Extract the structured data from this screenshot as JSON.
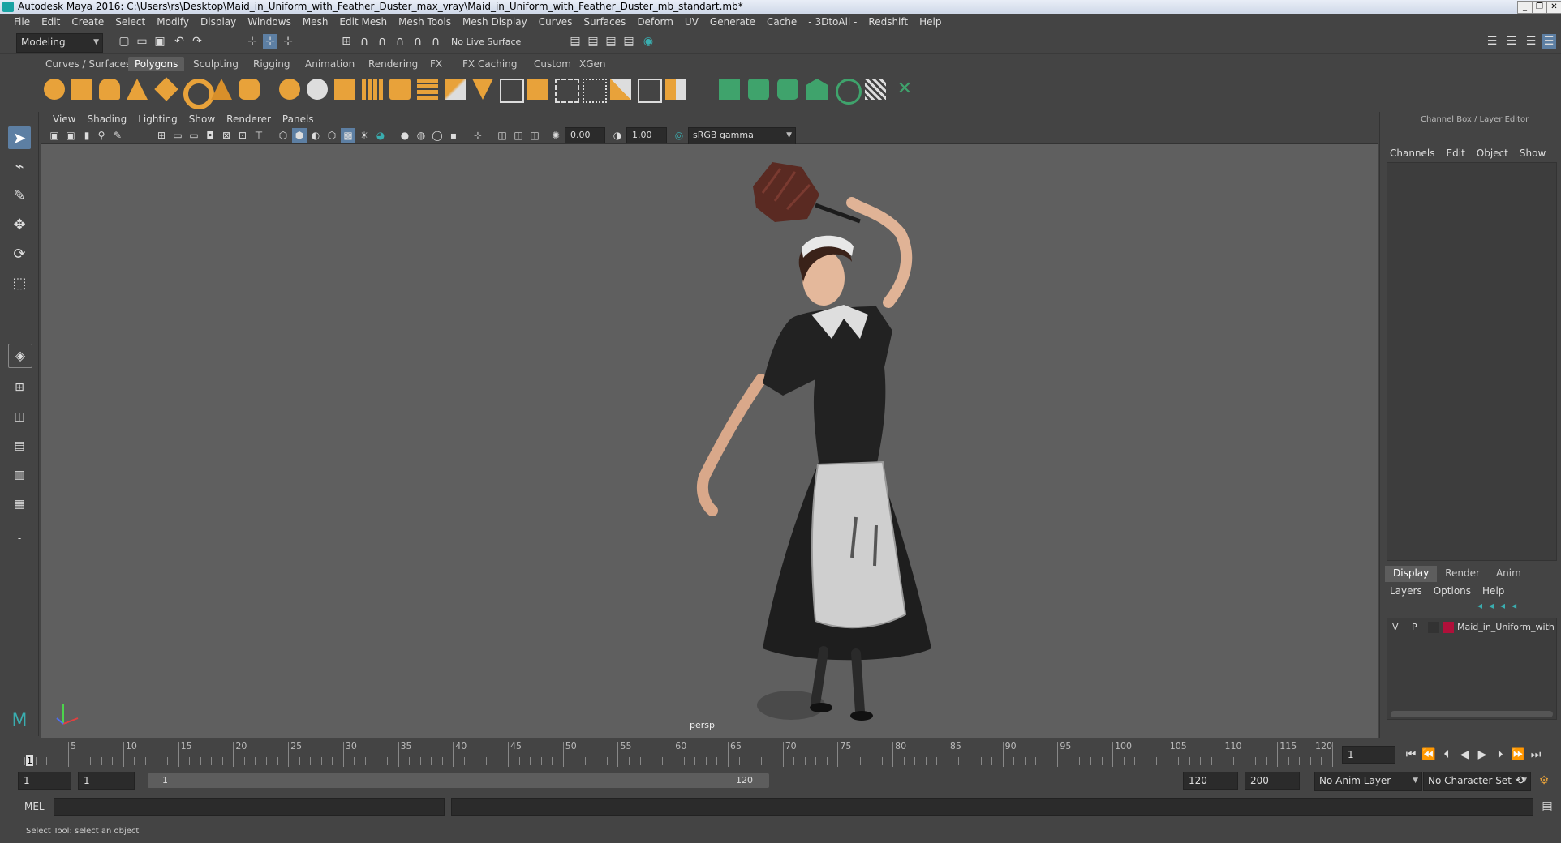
{
  "window": {
    "title": "Autodesk Maya 2016: C:\\Users\\rs\\Desktop\\Maid_in_Uniform_with_Feather_Duster_max_vray\\Maid_in_Uniform_with_Feather_Duster_mb_standart.mb*"
  },
  "menus": [
    "File",
    "Edit",
    "Create",
    "Select",
    "Modify",
    "Display",
    "Windows",
    "Mesh",
    "Edit Mesh",
    "Mesh Tools",
    "Mesh Display",
    "Curves",
    "Surfaces",
    "Deform",
    "UV",
    "Generate",
    "Cache",
    "- 3DtoAll -",
    "Redshift",
    "Help"
  ],
  "statusline": {
    "mode": "Modeling",
    "live_surface": "No Live Surface"
  },
  "shelf_tabs": [
    "Curves / Surfaces",
    "Polygons",
    "Sculpting",
    "Rigging",
    "Animation",
    "Rendering",
    "FX",
    "FX Caching",
    "Custom",
    "XGen"
  ],
  "shelf_active": "Polygons",
  "viewport": {
    "menus": [
      "View",
      "Shading",
      "Lighting",
      "Show",
      "Renderer",
      "Panels"
    ],
    "exposure": "0.00",
    "gamma": "1.00",
    "color_space": "sRGB gamma",
    "camera_label": "persp"
  },
  "channel_box": {
    "title": "Channel Box / Layer Editor",
    "menus": [
      "Channels",
      "Edit",
      "Object",
      "Show"
    ],
    "layer_tabs": [
      "Display",
      "Render",
      "Anim"
    ],
    "layer_menus": [
      "Layers",
      "Options",
      "Help"
    ],
    "layer": {
      "v": "V",
      "p": "P",
      "name": "Maid_in_Uniform_with",
      "color": "#b0103a"
    }
  },
  "timeline": {
    "ticks": [
      "5",
      "10",
      "15",
      "20",
      "25",
      "30",
      "35",
      "40",
      "45",
      "50",
      "55",
      "60",
      "65",
      "70",
      "75",
      "80",
      "85",
      "90",
      "95",
      "100",
      "105",
      "110",
      "115",
      "120"
    ],
    "start_marker": "1",
    "current_frame": "1"
  },
  "range": {
    "start": "1",
    "playback_start": "1",
    "slider_start": "1",
    "slider_end": "120",
    "playback_end": "120",
    "end": "200",
    "anim_layer": "No Anim Layer",
    "character_set": "No Character Set"
  },
  "command_line": {
    "label": "MEL"
  },
  "help_line": "Select Tool: select an object",
  "colors": {
    "accent_teal": "#3aaeb0",
    "shelf_orange": "#e8a23a",
    "shelf_green": "#3fa36c",
    "selection_blue": "#4d8fd1"
  }
}
